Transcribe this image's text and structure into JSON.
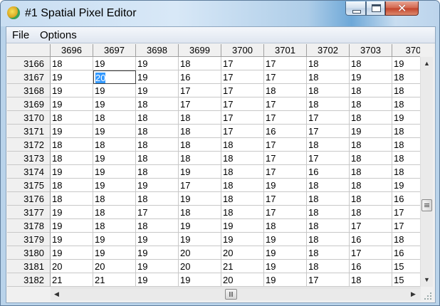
{
  "window": {
    "title": "#1 Spatial Pixel Editor"
  },
  "menu": [
    "File",
    "Options"
  ],
  "grid": {
    "columns": [
      "3696",
      "3697",
      "3698",
      "3699",
      "3700",
      "3701",
      "3702",
      "3703",
      "370"
    ],
    "rows": [
      {
        "label": "3166",
        "values": [
          "18",
          "19",
          "19",
          "18",
          "17",
          "17",
          "18",
          "18",
          "19"
        ]
      },
      {
        "label": "3167",
        "values": [
          "19",
          "20",
          "19",
          "16",
          "17",
          "17",
          "18",
          "19",
          "18"
        ]
      },
      {
        "label": "3168",
        "values": [
          "19",
          "19",
          "19",
          "17",
          "17",
          "18",
          "18",
          "18",
          "18"
        ]
      },
      {
        "label": "3169",
        "values": [
          "19",
          "19",
          "18",
          "17",
          "17",
          "17",
          "18",
          "18",
          "18"
        ]
      },
      {
        "label": "3170",
        "values": [
          "18",
          "18",
          "18",
          "18",
          "17",
          "17",
          "17",
          "18",
          "19"
        ]
      },
      {
        "label": "3171",
        "values": [
          "19",
          "19",
          "18",
          "18",
          "17",
          "16",
          "17",
          "19",
          "18"
        ]
      },
      {
        "label": "3172",
        "values": [
          "18",
          "18",
          "18",
          "18",
          "18",
          "17",
          "18",
          "18",
          "18"
        ]
      },
      {
        "label": "3173",
        "values": [
          "18",
          "19",
          "18",
          "18",
          "18",
          "17",
          "17",
          "18",
          "18"
        ]
      },
      {
        "label": "3174",
        "values": [
          "19",
          "19",
          "18",
          "19",
          "18",
          "17",
          "16",
          "18",
          "18"
        ]
      },
      {
        "label": "3175",
        "values": [
          "18",
          "19",
          "19",
          "17",
          "18",
          "19",
          "18",
          "18",
          "19"
        ]
      },
      {
        "label": "3176",
        "values": [
          "18",
          "18",
          "18",
          "19",
          "18",
          "17",
          "18",
          "18",
          "16"
        ]
      },
      {
        "label": "3177",
        "values": [
          "19",
          "18",
          "17",
          "18",
          "18",
          "17",
          "18",
          "18",
          "17"
        ]
      },
      {
        "label": "3178",
        "values": [
          "19",
          "18",
          "18",
          "19",
          "19",
          "18",
          "18",
          "17",
          "17"
        ]
      },
      {
        "label": "3179",
        "values": [
          "19",
          "19",
          "19",
          "19",
          "19",
          "19",
          "18",
          "16",
          "18"
        ]
      },
      {
        "label": "3180",
        "values": [
          "19",
          "19",
          "19",
          "20",
          "20",
          "19",
          "18",
          "17",
          "16"
        ]
      },
      {
        "label": "3181",
        "values": [
          "20",
          "20",
          "19",
          "20",
          "21",
          "19",
          "18",
          "16",
          "15"
        ]
      },
      {
        "label": "3182",
        "values": [
          "21",
          "21",
          "19",
          "19",
          "20",
          "19",
          "17",
          "18",
          "15"
        ]
      }
    ],
    "selected": {
      "row": 1,
      "col": 1
    }
  },
  "icons": {
    "minimize": "minimize-icon",
    "maximize": "maximize-icon",
    "close": "close-icon",
    "close_glyph": "✕",
    "scroll_up": "▲",
    "scroll_down": "▼",
    "scroll_left": "◀",
    "scroll_right": "▶"
  }
}
